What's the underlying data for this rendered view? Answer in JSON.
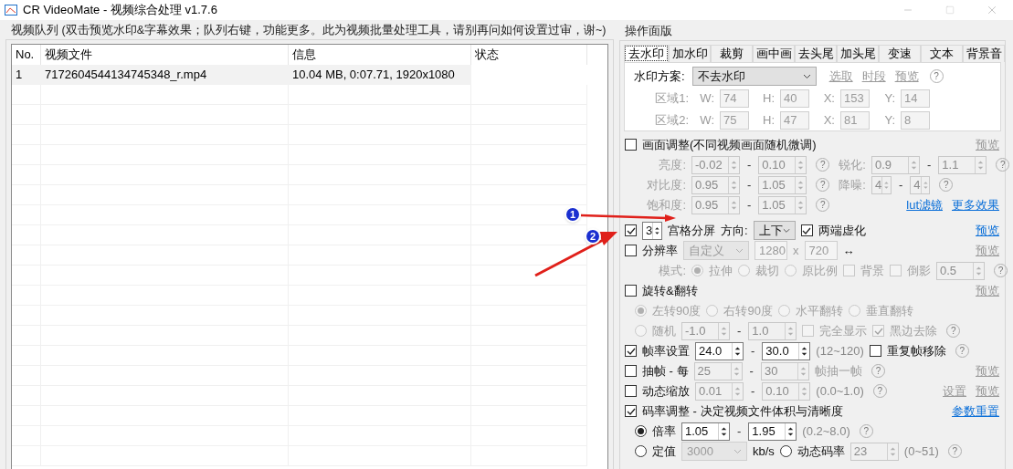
{
  "window": {
    "title": "CR VideoMate - 视频综合处理 v1.7.6"
  },
  "queue": {
    "title": "视频队列 (双击预览水印&字幕效果；队列右键，功能更多。此为视频批量处理工具，请别再问如何设置过审，谢~)",
    "columns": [
      "No.",
      "视频文件",
      "信息",
      "状态"
    ],
    "rows": [
      {
        "no": "1",
        "file": "7172604544134745348_r.mp4",
        "info": "10.04 MB, 0:07.71, 1920x1080",
        "selected": true
      }
    ]
  },
  "panel": {
    "title": "操作面版",
    "tabs": [
      {
        "label": "去水印",
        "selected": true
      },
      {
        "label": "加水印",
        "selected": false
      },
      {
        "label": "裁剪",
        "selected": false
      },
      {
        "label": "画中画",
        "selected": false
      },
      {
        "label": "去头尾",
        "selected": false
      },
      {
        "label": "加头尾",
        "selected": false
      },
      {
        "label": "变速",
        "selected": false
      },
      {
        "label": "文本",
        "selected": false
      },
      {
        "label": "背景音",
        "selected": false
      }
    ],
    "watermark": {
      "label": "水印方案:",
      "value": "不去水印",
      "links": [
        "选取",
        "时段",
        "预览"
      ],
      "help": "?",
      "regions": [
        {
          "label": "区域1:",
          "fields": [
            {
              "label": "W:",
              "value": "74"
            },
            {
              "label": "H:",
              "value": "40"
            },
            {
              "label": "X:",
              "value": "153"
            },
            {
              "label": "Y:",
              "value": "14"
            }
          ]
        },
        {
          "label": "区域2:",
          "fields": [
            {
              "label": "W:",
              "value": "75"
            },
            {
              "label": "H:",
              "value": "47"
            },
            {
              "label": "X:",
              "value": "81"
            },
            {
              "label": "Y:",
              "value": "8"
            }
          ]
        }
      ]
    },
    "rows": [
      {
        "kind": "head",
        "items": [
          {
            "kind": "check",
            "label": "画面调整(不同视频画面随机微调)",
            "checked": false,
            "disabled": false
          }
        ],
        "right": [
          {
            "text": "预览",
            "disabled": true
          }
        ]
      },
      {
        "kind": "sub",
        "items": [
          {
            "kind": "label",
            "text": "亮度:",
            "disabled": true
          },
          {
            "kind": "spin",
            "value": "-0.02",
            "disabled": true
          },
          {
            "kind": "dash",
            "text": "-"
          },
          {
            "kind": "spin",
            "value": "0.10",
            "disabled": true
          },
          {
            "kind": "help",
            "text": "?"
          },
          {
            "kind": "label",
            "text": "锐化:",
            "disabled": true
          },
          {
            "kind": "spin",
            "value": "0.9",
            "disabled": true
          },
          {
            "kind": "dash",
            "text": "-"
          },
          {
            "kind": "spin",
            "value": "1.1",
            "disabled": true
          },
          {
            "kind": "help",
            "text": "?"
          }
        ]
      },
      {
        "kind": "sub",
        "items": [
          {
            "kind": "label",
            "text": "对比度:",
            "disabled": true
          },
          {
            "kind": "spin",
            "value": "0.95",
            "disabled": true
          },
          {
            "kind": "dash",
            "text": "-"
          },
          {
            "kind": "spin",
            "value": "1.05",
            "disabled": true
          },
          {
            "kind": "help",
            "text": "?"
          },
          {
            "kind": "label",
            "text": "降噪:",
            "disabled": true
          },
          {
            "kind": "spin",
            "value": "4",
            "disabled": true
          },
          {
            "kind": "dash",
            "text": "-"
          },
          {
            "kind": "spin",
            "value": "4",
            "disabled": true
          },
          {
            "kind": "help",
            "text": "?"
          }
        ]
      },
      {
        "kind": "sub",
        "items": [
          {
            "kind": "label",
            "text": "饱和度:",
            "disabled": true
          },
          {
            "kind": "spin",
            "value": "0.95",
            "disabled": true
          },
          {
            "kind": "dash",
            "text": "-"
          },
          {
            "kind": "spin",
            "value": "1.05",
            "disabled": true
          },
          {
            "kind": "help",
            "text": "?"
          }
        ],
        "right": [
          {
            "text": "lut滤镜",
            "disabled": false
          },
          {
            "text": "更多效果",
            "disabled": false
          }
        ]
      },
      {
        "kind": "head",
        "items": [
          {
            "kind": "check",
            "checked": true,
            "disabled": false
          },
          {
            "kind": "spin",
            "value": "3",
            "disabled": false
          },
          {
            "kind": "label",
            "text": "宫格分屏",
            "disabled": false
          },
          {
            "kind": "label",
            "text": "方向:",
            "disabled": false
          },
          {
            "kind": "select",
            "value": "上下",
            "disabled": false
          },
          {
            "kind": "check",
            "label": "两端虚化",
            "checked": true,
            "disabled": false
          }
        ],
        "right": [
          {
            "text": "预览",
            "disabled": false
          }
        ]
      },
      {
        "kind": "head",
        "items": [
          {
            "kind": "check",
            "label": "分辨率",
            "checked": false,
            "disabled": false
          },
          {
            "kind": "select",
            "value": "自定义",
            "disabled": true
          },
          {
            "kind": "input",
            "value": "1280",
            "disabled": true
          },
          {
            "kind": "label",
            "text": "x",
            "disabled": true
          },
          {
            "kind": "input",
            "value": "720",
            "disabled": true
          },
          {
            "kind": "label",
            "text": "↔",
            "disabled": false
          }
        ],
        "right": [
          {
            "text": "预览",
            "disabled": true
          }
        ]
      },
      {
        "kind": "sub",
        "items": [
          {
            "kind": "label",
            "text": "模式:",
            "disabled": true
          },
          {
            "kind": "radio",
            "label": "拉伸",
            "selected": true,
            "disabled": true
          },
          {
            "kind": "radio",
            "label": "裁切",
            "selected": false,
            "disabled": true
          },
          {
            "kind": "radio",
            "label": "原比例",
            "selected": false,
            "disabled": true
          },
          {
            "kind": "check",
            "label": "背景",
            "checked": false,
            "disabled": true
          },
          {
            "kind": "check",
            "label": "倒影",
            "checked": false,
            "disabled": true
          },
          {
            "kind": "spin",
            "value": "0.5",
            "disabled": true
          },
          {
            "kind": "help",
            "text": "?"
          }
        ]
      },
      {
        "kind": "head",
        "items": [
          {
            "kind": "check",
            "label": "旋转&翻转",
            "checked": false,
            "disabled": false
          }
        ],
        "right": [
          {
            "text": "预览",
            "disabled": true
          }
        ]
      },
      {
        "kind": "sub",
        "items": [
          {
            "kind": "radio",
            "label": "左转90度",
            "selected": true,
            "disabled": true
          },
          {
            "kind": "radio",
            "label": "右转90度",
            "selected": false,
            "disabled": true
          },
          {
            "kind": "radio",
            "label": "水平翻转",
            "selected": false,
            "disabled": true
          },
          {
            "kind": "radio",
            "label": "垂直翻转",
            "selected": false,
            "disabled": true
          }
        ]
      },
      {
        "kind": "sub",
        "items": [
          {
            "kind": "radio",
            "label": "随机",
            "selected": false,
            "disabled": true
          },
          {
            "kind": "spin",
            "value": "-1.0",
            "disabled": true
          },
          {
            "kind": "dash",
            "text": "-"
          },
          {
            "kind": "spin",
            "value": "1.0",
            "disabled": true
          },
          {
            "kind": "check",
            "label": "完全显示",
            "checked": false,
            "disabled": true
          },
          {
            "kind": "check",
            "label": "黑边去除",
            "checked": true,
            "disabled": true
          },
          {
            "kind": "help",
            "text": "?"
          }
        ]
      },
      {
        "kind": "head",
        "items": [
          {
            "kind": "check",
            "label": "帧率设置",
            "checked": true,
            "disabled": false
          },
          {
            "kind": "spin",
            "value": "24.0",
            "disabled": false
          },
          {
            "kind": "dash",
            "text": "-"
          },
          {
            "kind": "spin",
            "value": "30.0",
            "disabled": false
          },
          {
            "kind": "note",
            "text": "(12~120)"
          },
          {
            "kind": "check",
            "label": "重复帧移除",
            "checked": false,
            "disabled": false
          },
          {
            "kind": "help",
            "text": "?"
          }
        ]
      },
      {
        "kind": "head",
        "items": [
          {
            "kind": "check",
            "label": "抽帧 - 每",
            "checked": false,
            "disabled": false
          },
          {
            "kind": "spin",
            "value": "25",
            "disabled": true
          },
          {
            "kind": "dash",
            "text": "-"
          },
          {
            "kind": "spin",
            "value": "30",
            "disabled": true
          },
          {
            "kind": "label",
            "text": "帧抽一帧",
            "disabled": true
          },
          {
            "kind": "help",
            "text": "?"
          }
        ],
        "right": [
          {
            "text": "预览",
            "disabled": true
          }
        ]
      },
      {
        "kind": "head",
        "items": [
          {
            "kind": "check",
            "label": "动态缩放",
            "checked": false,
            "disabled": false
          },
          {
            "kind": "spin",
            "value": "0.01",
            "disabled": true
          },
          {
            "kind": "dash",
            "text": "-"
          },
          {
            "kind": "spin",
            "value": "0.10",
            "disabled": true
          },
          {
            "kind": "note",
            "text": "(0.0~1.0)"
          },
          {
            "kind": "help",
            "text": "?"
          }
        ],
        "right": [
          {
            "text": "设置",
            "disabled": true
          },
          {
            "text": "预览",
            "disabled": true
          }
        ]
      },
      {
        "kind": "head",
        "items": [
          {
            "kind": "check",
            "label": "码率调整 - 决定视频文件体积与清晰度",
            "checked": true,
            "disabled": false
          }
        ],
        "right": [
          {
            "text": "参数重置",
            "disabled": false
          }
        ]
      },
      {
        "kind": "sub",
        "items": [
          {
            "kind": "radio",
            "label": "倍率",
            "selected": true,
            "disabled": false
          },
          {
            "kind": "spin",
            "value": "1.05",
            "disabled": false
          },
          {
            "kind": "dash",
            "text": "-"
          },
          {
            "kind": "spin",
            "value": "1.95",
            "disabled": false
          },
          {
            "kind": "note",
            "text": "(0.2~8.0)"
          },
          {
            "kind": "help",
            "text": "?"
          }
        ]
      },
      {
        "kind": "sub",
        "items": [
          {
            "kind": "radio",
            "label": "定值",
            "selected": false,
            "disabled": false
          },
          {
            "kind": "select",
            "value": "3000",
            "disabled": true
          },
          {
            "kind": "label",
            "text": "kb/s",
            "disabled": false
          },
          {
            "kind": "radio",
            "label": "动态码率",
            "selected": false,
            "disabled": false
          },
          {
            "kind": "spin",
            "value": "23",
            "disabled": true
          },
          {
            "kind": "note",
            "text": "(0~51)"
          },
          {
            "kind": "help",
            "text": "?"
          }
        ]
      }
    ]
  },
  "annotations": [
    {
      "number": "1"
    },
    {
      "number": "2"
    }
  ]
}
